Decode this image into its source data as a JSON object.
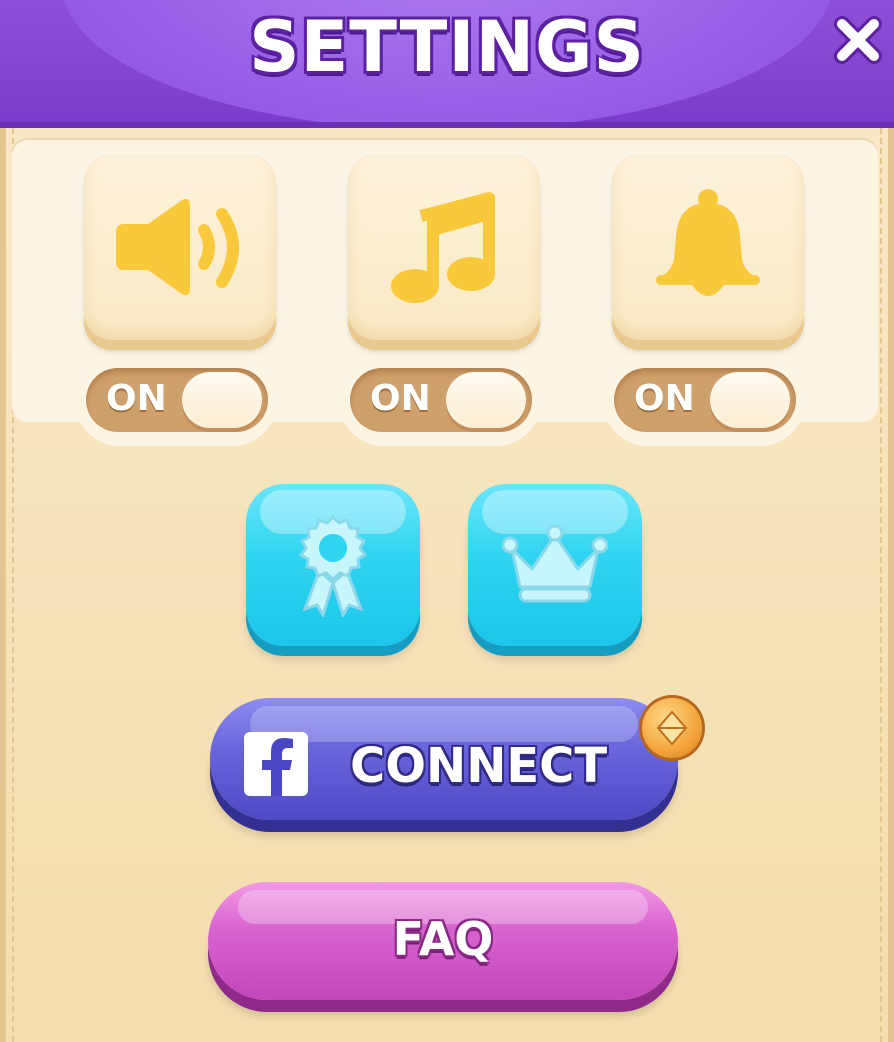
{
  "header": {
    "title": "SETTINGS",
    "close_icon": "close-icon"
  },
  "toggles": [
    {
      "name": "sound",
      "icon": "speaker-icon",
      "state_label": "ON"
    },
    {
      "name": "music",
      "icon": "music-note-icon",
      "state_label": "ON"
    },
    {
      "name": "notifications",
      "icon": "bell-icon",
      "state_label": "ON"
    }
  ],
  "icon_buttons": [
    {
      "name": "achievements",
      "icon": "ribbon-badge-icon"
    },
    {
      "name": "leaderboard",
      "icon": "crown-icon"
    }
  ],
  "connect_button": {
    "label": "CONNECT",
    "icon": "facebook-icon",
    "badge_icon": "coin-icon"
  },
  "faq_button": {
    "label": "FAQ"
  },
  "colors": {
    "header_purple": "#8e4fd8",
    "panel_beige": "#f6e2b8",
    "icon_yellow": "#f8c93a",
    "cyan_button": "#2fd4f0",
    "connect_blue": "#5a54d0",
    "faq_pink": "#d863cf"
  }
}
